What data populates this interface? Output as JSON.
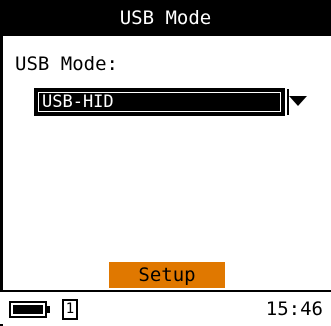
{
  "title": "USB Mode",
  "usb_mode": {
    "label": "USB Mode:",
    "selected_value": "USB-HID"
  },
  "setup_button": {
    "label": "Setup",
    "color": "#e07800"
  },
  "status_bar": {
    "sim_slot": "1",
    "time": "15:46",
    "icons": [
      "battery-icon",
      "sim-card-icon"
    ]
  }
}
